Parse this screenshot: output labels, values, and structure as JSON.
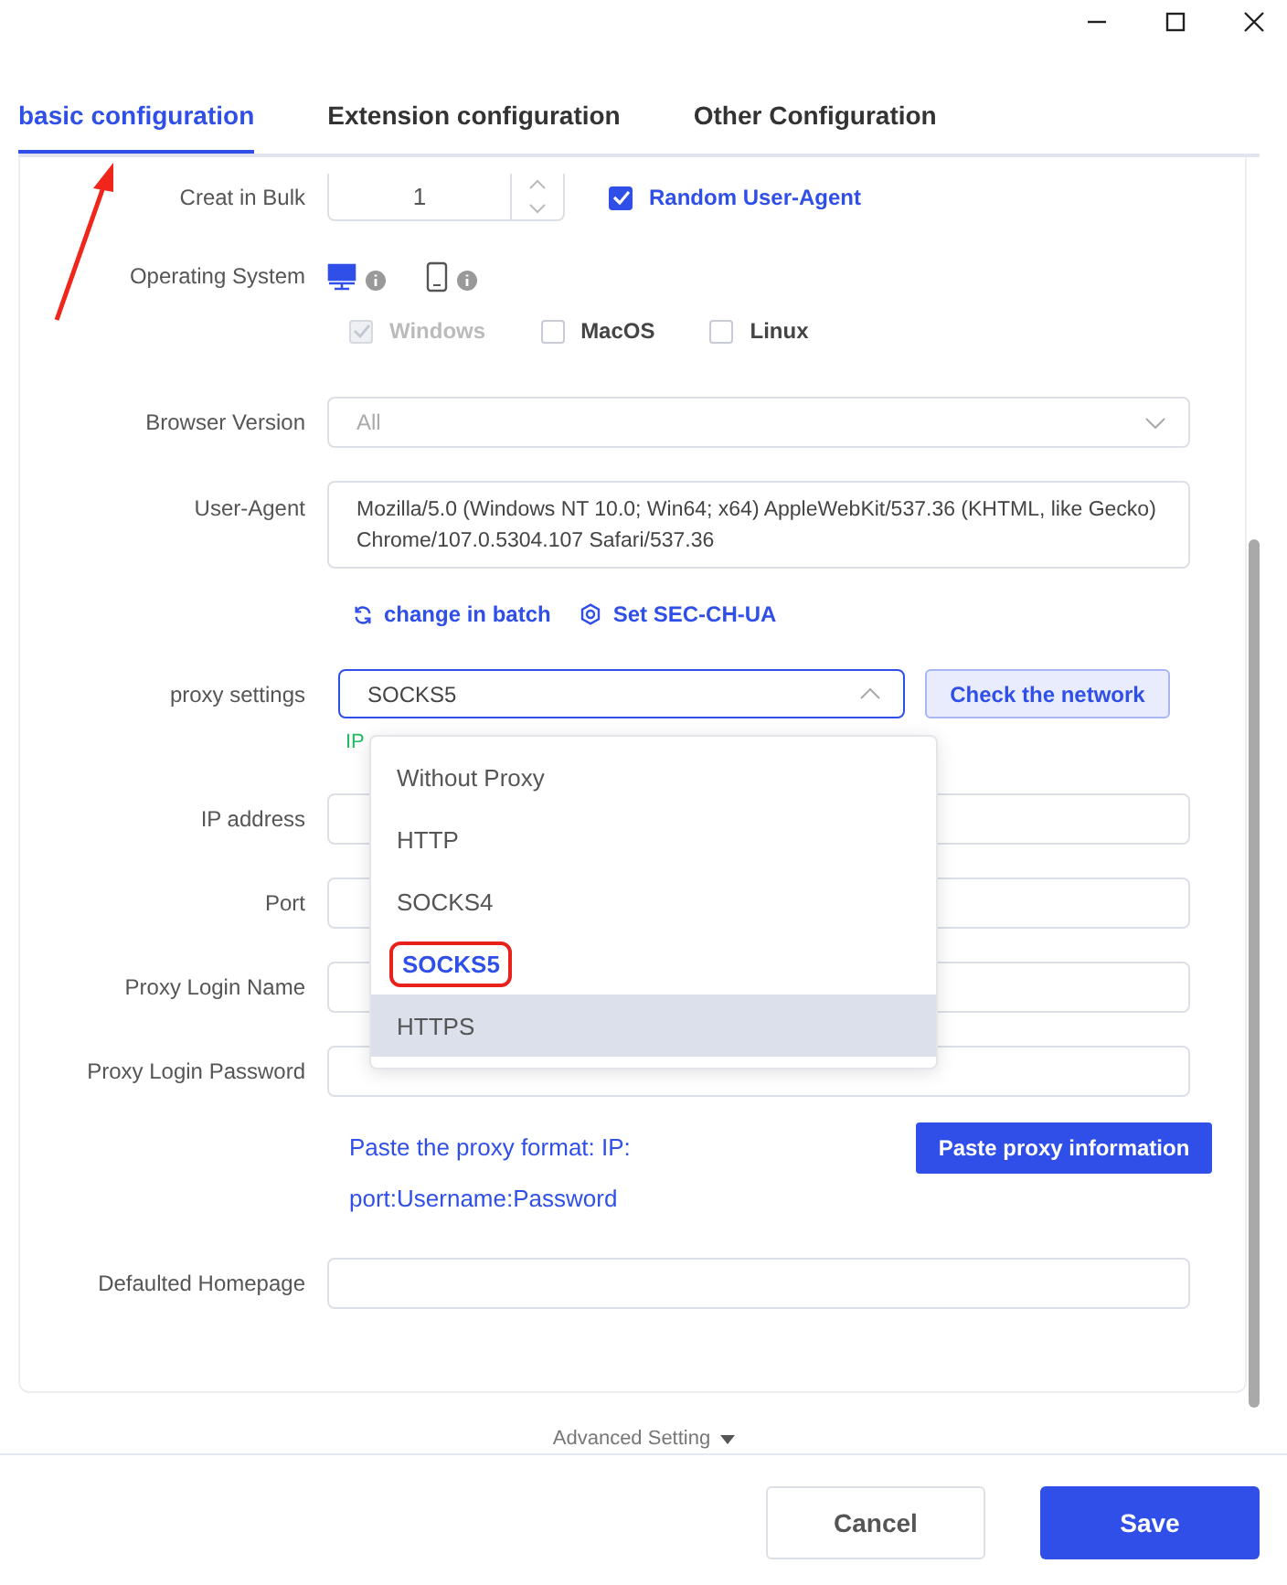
{
  "tabs": [
    {
      "label": "basic configuration",
      "selected": true
    },
    {
      "label": "Extension configuration",
      "selected": false
    },
    {
      "label": "Other Configuration",
      "selected": false
    }
  ],
  "bulk": {
    "label": "Creat in Bulk",
    "value": "1"
  },
  "random_ua": {
    "label": "Random User-Agent",
    "checked": true
  },
  "os": {
    "label": "Operating System",
    "devices": [
      {
        "kind": "desktop",
        "selected": true
      },
      {
        "kind": "mobile",
        "selected": false
      }
    ],
    "options": [
      {
        "label": "Windows",
        "checked": true,
        "disabled": true
      },
      {
        "label": "MacOS",
        "checked": false,
        "disabled": false
      },
      {
        "label": "Linux",
        "checked": false,
        "disabled": false
      }
    ]
  },
  "browser_version": {
    "label": "Browser Version",
    "placeholder": "All"
  },
  "user_agent": {
    "label": "User-Agent",
    "value": "Mozilla/5.0 (Windows NT 10.0; Win64; x64) AppleWebKit/537.36 (KHTML, like Gecko) Chrome/107.0.5304.107 Safari/537.36"
  },
  "ua_links": [
    {
      "kind": "refresh",
      "label": "change in batch"
    },
    {
      "kind": "gear",
      "label": "Set SEC-CH-UA"
    }
  ],
  "proxy": {
    "label": "proxy settings",
    "value": "SOCKS5",
    "expanded": true,
    "check_button": "Check the network",
    "status": "IP",
    "options": [
      {
        "label": "Without Proxy",
        "selected": false,
        "hovered": false,
        "annotated": false
      },
      {
        "label": "HTTP",
        "selected": false,
        "hovered": false,
        "annotated": false
      },
      {
        "label": "SOCKS4",
        "selected": false,
        "hovered": false,
        "annotated": false
      },
      {
        "label": "SOCKS5",
        "selected": true,
        "hovered": false,
        "annotated": true
      },
      {
        "label": "HTTPS",
        "selected": false,
        "hovered": true,
        "annotated": false
      }
    ]
  },
  "proxy_fields": [
    {
      "label": "IP address"
    },
    {
      "label": "Port"
    },
    {
      "label": "Proxy Login Name"
    },
    {
      "label": "Proxy Login Password"
    }
  ],
  "paste": {
    "hint": "Paste the proxy format: IP: port:Username:Password",
    "button": "Paste proxy information"
  },
  "homepage": {
    "label": "Defaulted Homepage"
  },
  "advanced": {
    "label": "Advanced Setting"
  },
  "buttons": [
    {
      "kind": "secondary",
      "label": "Cancel"
    },
    {
      "kind": "primary",
      "label": "Save"
    }
  ]
}
